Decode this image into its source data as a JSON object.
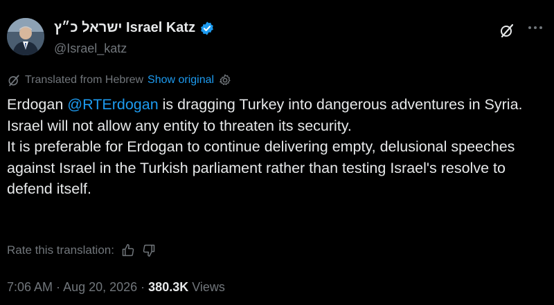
{
  "author": {
    "display_name": "ישראל כ״ץ Israel Katz",
    "handle": "@Israel_katz",
    "verified": true,
    "avatar_icon": "person-photo"
  },
  "header": {
    "grok_icon": "grok-icon",
    "more_icon": "more-icon"
  },
  "translation": {
    "label": "Translated from Hebrew",
    "show_original": "Show original",
    "settings_icon": "gear-icon"
  },
  "tweet": {
    "line1_prefix": "Erdogan ",
    "mention": "@RTErdogan",
    "line1_suffix": " is dragging Turkey into dangerous adventures in Syria.",
    "paragraph2": "Israel will not allow any entity to threaten its security.",
    "paragraph3": "It is preferable for Erdogan to continue delivering empty, delusional speeches against Israel in the Turkish parliament rather than testing Israel's resolve to defend itself."
  },
  "rating": {
    "label": "Rate this translation:",
    "thumbs_up_icon": "thumbs-up-icon",
    "thumbs_down_icon": "thumbs-down-icon"
  },
  "meta": {
    "time": "7:06 AM",
    "separator": " · ",
    "date": "Aug 20, 2026",
    "views_count": "380.3K",
    "views_label": " Views"
  },
  "colors": {
    "background": "#000000",
    "text": "#e7e9ea",
    "secondary": "#71767b",
    "accent": "#1d9bf0"
  }
}
